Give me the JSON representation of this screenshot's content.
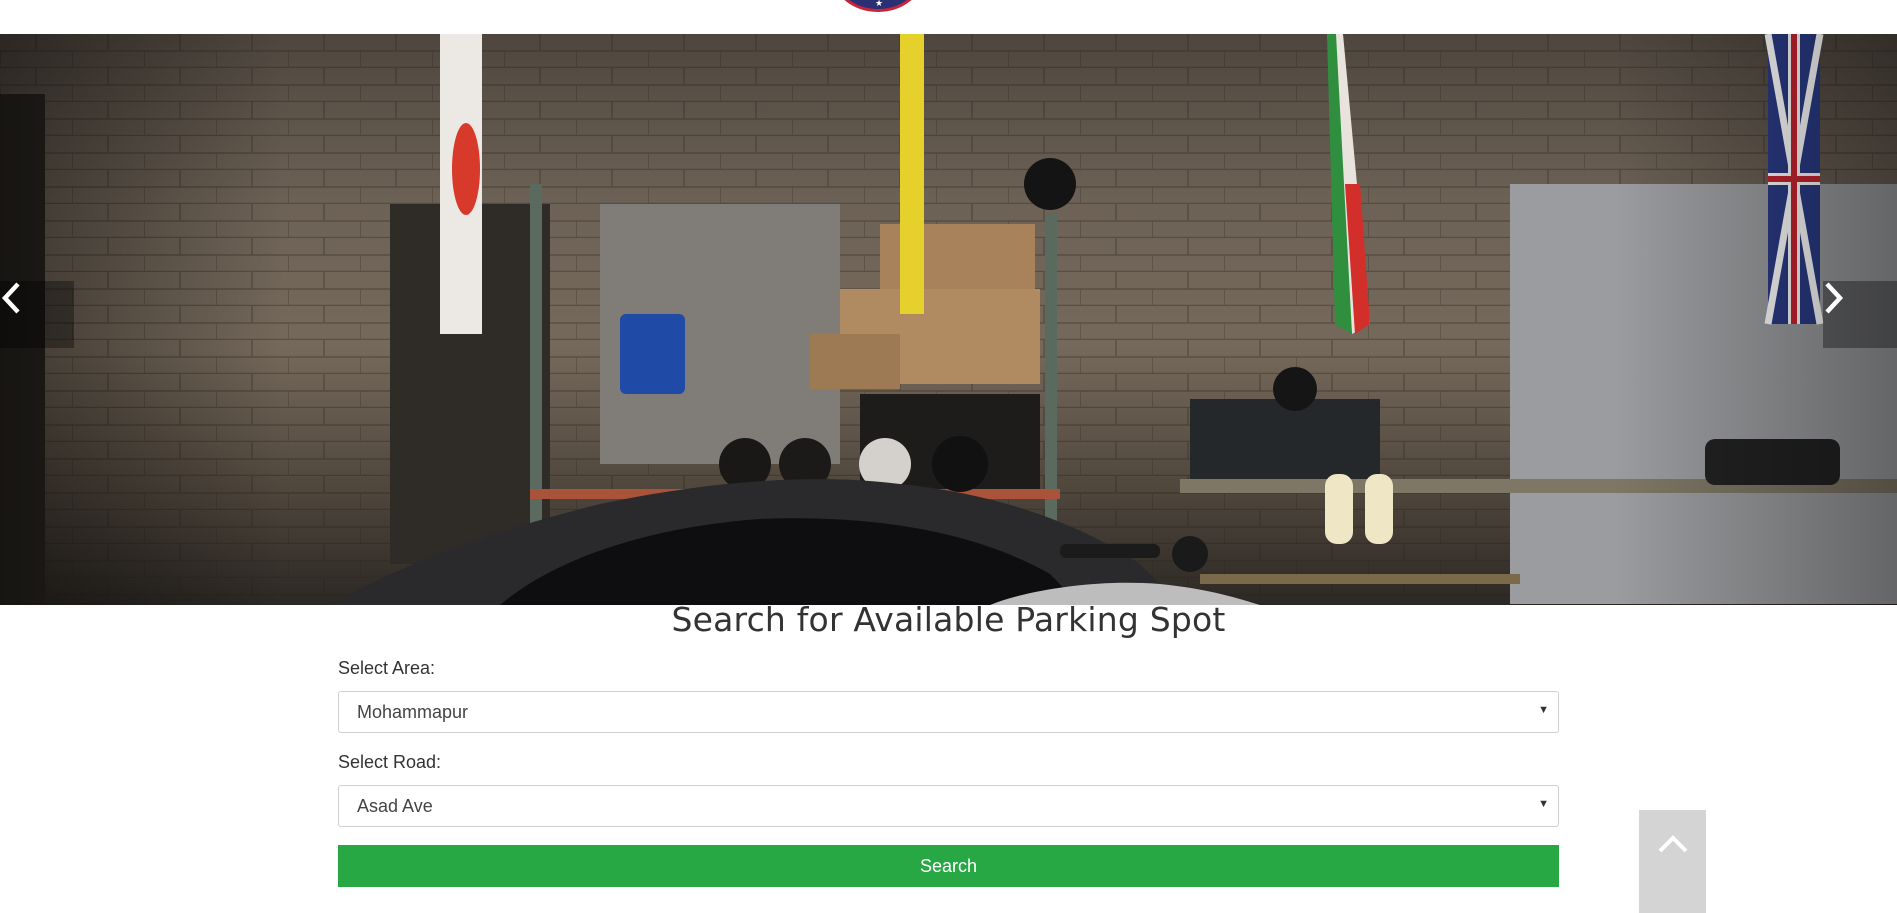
{
  "header": {
    "logo_icon": "badge-logo-icon"
  },
  "carousel": {
    "prev_icon": "chevron-left-icon",
    "next_icon": "chevron-right-icon",
    "photo_subject": "garage-motorcycle-photo"
  },
  "search": {
    "title": "Search for Available Parking Spot",
    "area_label": "Select Area:",
    "area_value": "Mohammapur",
    "road_label": "Select Road:",
    "road_value": "Asad Ave",
    "button_label": "Search",
    "button_color": "#28a745"
  },
  "scroll_top": {
    "icon": "chevron-up-icon"
  }
}
